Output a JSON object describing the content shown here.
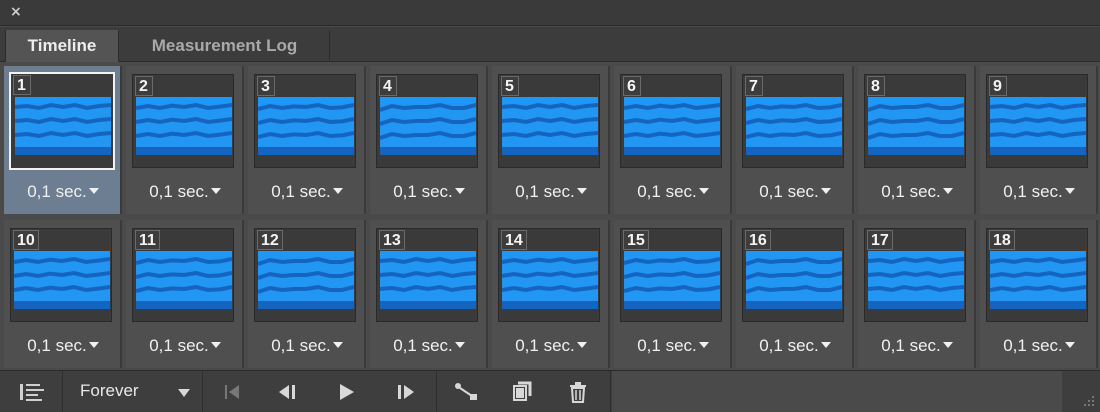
{
  "window": {
    "close_glyph": "×"
  },
  "tabs": [
    {
      "label": "Timeline",
      "active": true
    },
    {
      "label": "Measurement Log",
      "active": false
    }
  ],
  "frames": [
    {
      "number": "1",
      "delay": "0,1 sec.",
      "selected": true
    },
    {
      "number": "2",
      "delay": "0,1 sec."
    },
    {
      "number": "3",
      "delay": "0,1 sec."
    },
    {
      "number": "4",
      "delay": "0,1 sec."
    },
    {
      "number": "5",
      "delay": "0,1 sec."
    },
    {
      "number": "6",
      "delay": "0,1 sec."
    },
    {
      "number": "7",
      "delay": "0,1 sec."
    },
    {
      "number": "8",
      "delay": "0,1 sec."
    },
    {
      "number": "9",
      "delay": "0,1 sec."
    },
    {
      "number": "10",
      "delay": "0,1 sec."
    },
    {
      "number": "11",
      "delay": "0,1 sec."
    },
    {
      "number": "12",
      "delay": "0,1 sec."
    },
    {
      "number": "13",
      "delay": "0,1 sec."
    },
    {
      "number": "14",
      "delay": "0,1 sec."
    },
    {
      "number": "15",
      "delay": "0,1 sec."
    },
    {
      "number": "16",
      "delay": "0,1 sec."
    },
    {
      "number": "17",
      "delay": "0,1 sec."
    },
    {
      "number": "18",
      "delay": "0,1 sec."
    }
  ],
  "toolbar": {
    "loop_option": "Forever",
    "icons": [
      "convert-to-video-timeline-icon",
      "first-frame-icon",
      "previous-frame-icon",
      "play-icon",
      "next-frame-icon",
      "tween-icon",
      "duplicate-frame-icon",
      "delete-frame-icon"
    ]
  },
  "colors": {
    "accent": "#2196f3",
    "wave": "#1565c0",
    "selected_frame": "#6d7d92"
  }
}
